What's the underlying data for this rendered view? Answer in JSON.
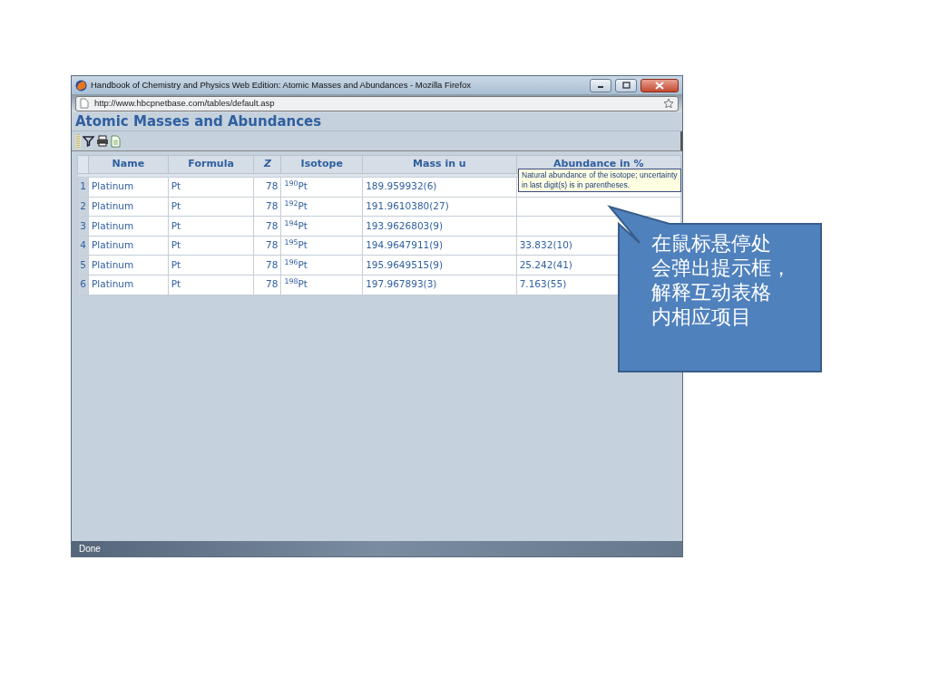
{
  "window": {
    "title": "Handbook of Chemistry and Physics Web Edition: Atomic Masses and Abundances - Mozilla Firefox",
    "url": "http://www.hbcpnetbase.com/tables/default.asp"
  },
  "page_title": "Atomic Masses and Abundances",
  "table": {
    "columns": [
      "Name",
      "Formula",
      "Z",
      "Isotope",
      "Mass in u",
      "Abundance in %"
    ],
    "rows": [
      {
        "number": "1",
        "cells": [
          "Platinum",
          "Pt",
          "78",
          "$^{190}$Pt",
          "189.959932(6)"
        ]
      },
      {
        "number": "2",
        "cells": [
          "Platinum",
          "Pt",
          "78",
          "$^{192}$Pt",
          "191.9610380(27)"
        ]
      },
      {
        "number": "3",
        "cells": [
          "Platinum",
          "Pt",
          "78",
          "$^{194}$Pt",
          "193.9626803(9)"
        ]
      },
      {
        "number": "4",
        "cells": [
          "Platinum",
          "Pt",
          "78",
          "$^{195}$Pt",
          "194.9647911(9)",
          "33.832(10)"
        ]
      },
      {
        "number": "5",
        "cells": [
          "Platinum",
          "Pt",
          "78",
          "$^{196}$Pt",
          "195.9649515(9)",
          "25.242(41)"
        ]
      },
      {
        "number": "6",
        "cells": [
          "Platinum",
          "Pt",
          "78",
          "$^{198}$Pt",
          "197.967893(3)",
          "7.163(55)"
        ]
      }
    ]
  },
  "tooltip": "Natural abundance of the isotope; uncertainty in last digit(s) is in parentheses.",
  "status_bar": "Done",
  "callout": {
    "lines": [
      "在鼠标悬停处",
      "会弹出提示框，",
      "解释互动表格",
      "内相应项目"
    ]
  }
}
